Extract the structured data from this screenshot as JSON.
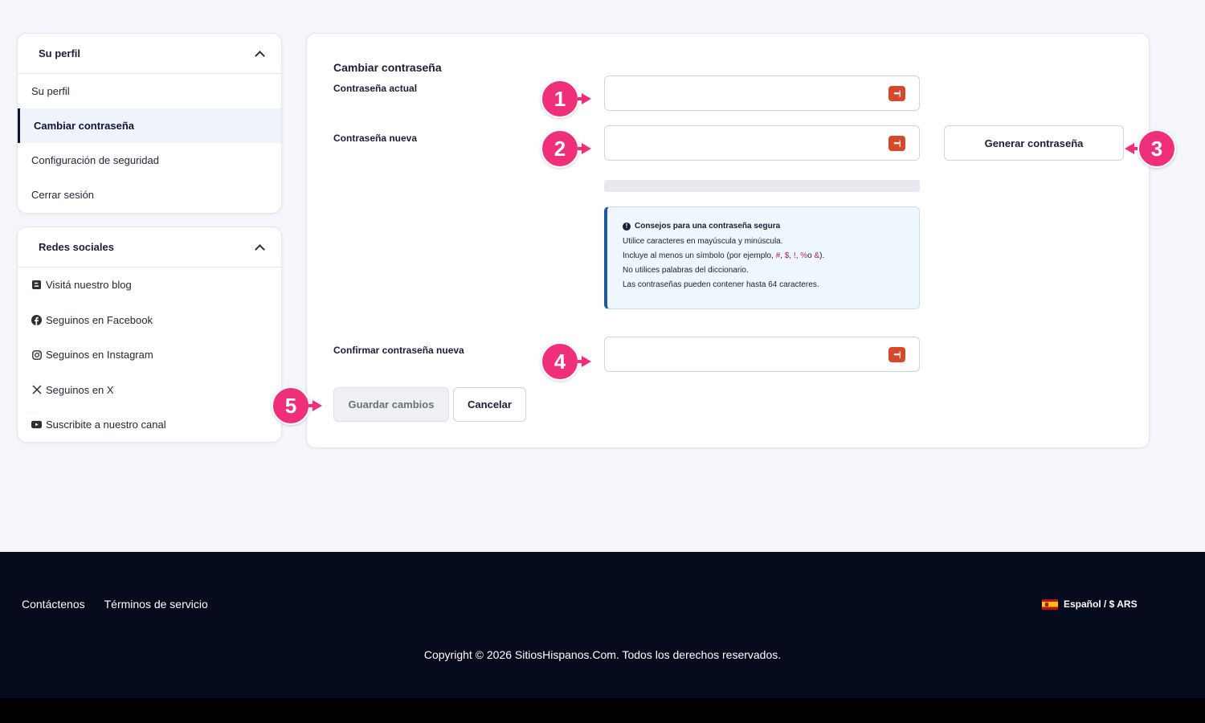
{
  "sidebar": {
    "profile": {
      "header": "Su perfil",
      "items": [
        "Su perfil",
        "Cambiar contraseña",
        "Configuración de seguridad",
        "Cerrar sesión"
      ],
      "active_index": 1
    },
    "social": {
      "header": "Redes sociales",
      "items": [
        {
          "label": "Visitá nuestro blog",
          "icon": "blogger-icon"
        },
        {
          "label": "Seguinos en Facebook",
          "icon": "facebook-icon"
        },
        {
          "label": "Seguinos en Instagram",
          "icon": "instagram-icon"
        },
        {
          "label": "Seguinos en X",
          "icon": "x-icon"
        },
        {
          "label": "Suscribite a nuestro canal",
          "icon": "youtube-icon"
        }
      ]
    }
  },
  "form": {
    "title": "Cambiar contraseña",
    "current_label": "Contraseña actual",
    "new_label": "Contraseña nueva",
    "confirm_label": "Confirmar contraseña nueva",
    "generate_label": "Generar contraseña",
    "save_label": "Guardar cambios",
    "cancel_label": "Cancelar",
    "password_key_glyph": "•••|",
    "tips": {
      "title": "Consejos para una contraseña segura",
      "info_glyph": "!",
      "line1": "Utilice caracteres en mayúscula y minúscula.",
      "line2_prefix": "Incluye al menos un símbolo (por ejemplo,",
      "symbols": [
        "#",
        "$",
        "!",
        "%"
      ],
      "sep_comma": ",",
      "sep_o": "o",
      "symbol_last": "&",
      "line2_suffix": ").",
      "line3": "No utilices palabras del diccionario.",
      "line4": "Las contraseñas pueden contener hasta 64 caracteres."
    }
  },
  "markers": [
    "1",
    "2",
    "3",
    "4",
    "5"
  ],
  "footer": {
    "links": [
      "Contáctenos",
      "Términos de servicio"
    ],
    "language": "Español / $ ARS",
    "copyright": "Copyright © 2026 SitiosHispanos.Com. Todos los derechos reservados."
  },
  "colors": {
    "accent_marker": "#ef2f7a",
    "footer_bg": "#060c1e",
    "active_border": "#0d1536",
    "tips_border": "#1f5b9b",
    "key_icon": "#d9472b"
  }
}
